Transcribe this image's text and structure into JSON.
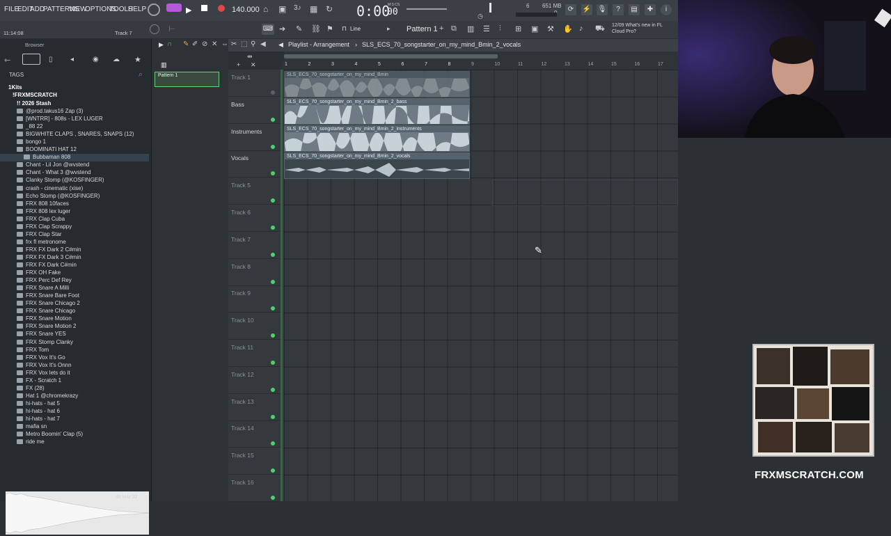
{
  "menu": [
    "FILE",
    "EDIT",
    "ADD",
    "PATTERNS",
    "VIEW",
    "OPTIONS",
    "TOOLS",
    "HELP"
  ],
  "transport": {
    "tempo": "140.000",
    "time": "0:00",
    "time_small": "00",
    "time_unit": "M:S:CS",
    "cpu": "6",
    "mem": "651 MB",
    "mem2": "0",
    "pattern": "Pattern 1",
    "snap": "Line",
    "hint": "12/09 What's new in FL Cloud Pro?"
  },
  "status": {
    "timestamp": "11:14:08",
    "track": "Track 7"
  },
  "browser": {
    "title": "Browser",
    "tags": "TAGS",
    "folders": [
      "1Kits",
      "!FRXMSCRATCH",
      "!! 2026 Stash"
    ],
    "items": [
      "@prod.takus16 Zap (3)",
      "[WNTRR] - 808s - LEX LUGER",
      "_88 22",
      "BIGWHITE CLAPS , SNARES, SNAPS (12)",
      "bongo 1",
      "BOOMINATI HAT 12",
      "Bubbaman 808",
      "Chant - Lil Jon @wvstend",
      "Chant - What 3 @wvstend",
      "Clanky Stomp (@KOSFINGER)",
      "crash - cinematic (xise)",
      "Echo Stomp (@KOSFINGER)",
      "FRX 808 10faces",
      "FRX 808 lex luger",
      "FRX Clap Cuba",
      "FRX Clap Scrappy",
      "FRX Clap Star",
      "frx fl metronome",
      "FRX FX Dark 2 C#min",
      "FRX FX Dark 3 C#min",
      "FRX FX Dark C#min",
      "FRX OH Fake",
      "FRX Perc Def Rey",
      "FRX Snare A Milli",
      "FRX Snare Bare Foot",
      "FRX Snare Chicago 2",
      "FRX Snare Chicago",
      "FRX Snare Motion",
      "FRX Snare Motion 2",
      "FRX Snare YES",
      "FRX Stomp Clanky",
      "FRX Tom",
      "FRX Vox It's Go",
      "FRX Vox It's Onnn",
      "FRX Vox lets do it",
      "FX - Scratch 1",
      "FX (28)",
      "Hat 1 @chromekrazy",
      "hi-hats - hat 5",
      "hi-hats - hat 6",
      "hi-hats - hat 7",
      "mafia sn",
      "Metro Boomin' Clap (5)",
      "ride me"
    ],
    "sample_info": "48 kHz 32"
  },
  "channel": {
    "pattern": "Pattern 1"
  },
  "playlist": {
    "title": "Playlist - Arrangement",
    "path": "SLS_ECS_70_songstarter_on_my_mind_Bmin_2_vocals"
  },
  "ruler": [
    "1",
    "2",
    "3",
    "4",
    "5",
    "6",
    "7",
    "8",
    "9",
    "10",
    "11",
    "12",
    "13",
    "14",
    "15",
    "16",
    "17"
  ],
  "tracks": [
    "Track 1",
    "Bass",
    "Instruments",
    "Vocals",
    "Track 5",
    "Track 6",
    "Track 7",
    "Track 8",
    "Track 9",
    "Track 10",
    "Track 11",
    "Track 12",
    "Track 13",
    "Track 14",
    "Track 15",
    "Track 16"
  ],
  "clips": [
    "SLS_ECS_70_songstarter_on_my_mind_Bmin",
    "SLS_ECS_70_songstarter_on_my_mind_Bmin_2_bass",
    "SLS_ECS_70_songstarter_on_my_mind_Bmin_2_instruments",
    "SLS_ECS_70_songstarter_on_my_mind_Bmin_2_vocals"
  ],
  "watermark": "FRXMSCRATCH.COM",
  "colors": {
    "accent": "#4fd16a",
    "record": "#e04848",
    "clip": "#6f7b84"
  }
}
